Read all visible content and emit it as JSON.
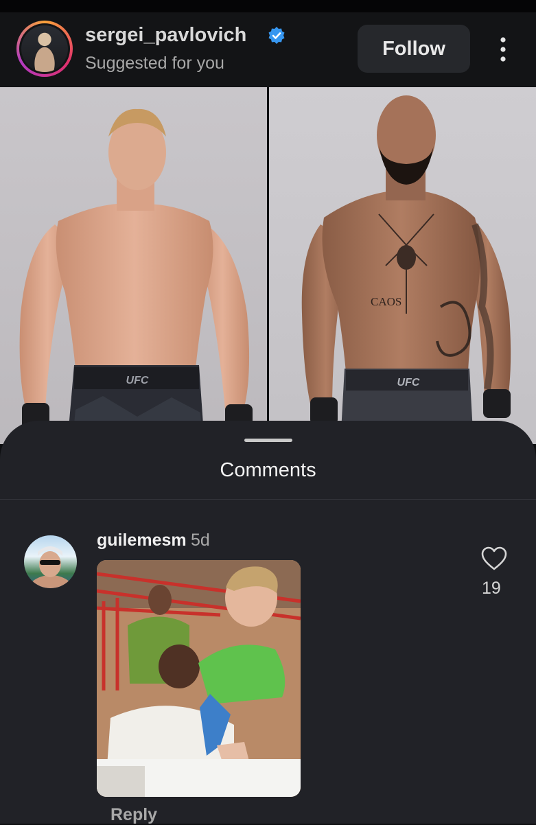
{
  "post": {
    "username": "sergei_pavlovich",
    "subtitle": "Suggested for you",
    "follow_label": "Follow",
    "photos": [
      {
        "trunks_text": "UFC"
      },
      {
        "trunks_text": "UFC",
        "tattoo_text": "CAOS"
      }
    ]
  },
  "comments_sheet": {
    "title": "Comments",
    "comments": [
      {
        "username": "guilemesm",
        "time": "5d",
        "likes": "19",
        "reply_label": "Reply"
      }
    ]
  },
  "colors": {
    "verified": "#3797f0",
    "background": "#0e0f11",
    "sheet": "#212227"
  }
}
